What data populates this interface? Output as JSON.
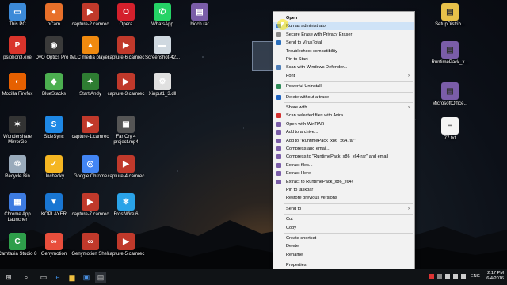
{
  "desktop_icons": [
    {
      "label": "This PC",
      "glyph": "▭",
      "color": "#3c8ad8"
    },
    {
      "label": "oCam",
      "glyph": "●",
      "color": "#e8702a"
    },
    {
      "label": "capture-2.camrec",
      "glyph": "▶",
      "color": "#c0392b"
    },
    {
      "label": "Opera",
      "glyph": "O",
      "color": "#d4202c"
    },
    {
      "label": "WhatsApp",
      "glyph": "✆",
      "color": "#25d366"
    },
    {
      "label": "bioch.rar",
      "glyph": "▤",
      "color": "#7a5da8"
    },
    {
      "label": "psiphon3.exe",
      "glyph": "P",
      "color": "#d9342b"
    },
    {
      "label": "DvO Optics Pro 8",
      "glyph": "◉",
      "color": "#3a3a3a"
    },
    {
      "label": "VLC media player",
      "glyph": "▲",
      "color": "#f08a0f"
    },
    {
      "label": "capture-6.camrec",
      "glyph": "▶",
      "color": "#c0392b"
    },
    {
      "label": "Screenshot-42...",
      "glyph": "▬",
      "color": "#cfd8e0"
    },
    {
      "label": "Mozilla Firefox",
      "glyph": "◐",
      "color": "#e66000"
    },
    {
      "label": "BlueStacks",
      "glyph": "◆",
      "color": "#4caf50"
    },
    {
      "label": "Start Andy",
      "glyph": "✦",
      "color": "#2e7d32"
    },
    {
      "label": "capture-3.camrec",
      "glyph": "▶",
      "color": "#c0392b"
    },
    {
      "label": "Xinput1_3.dll",
      "glyph": "⚙",
      "color": "#e0e0e0"
    },
    {
      "label": "Wondershare MirrorGo",
      "glyph": "✶",
      "color": "#333"
    },
    {
      "label": "SideSync",
      "glyph": "S",
      "color": "#1e88e5"
    },
    {
      "label": "capture-1.camrec",
      "glyph": "▶",
      "color": "#c0392b"
    },
    {
      "label": "Far Cry 4 project.mp4",
      "glyph": "▣",
      "color": "#555"
    },
    {
      "label": "Recycle Bin",
      "glyph": "♲",
      "color": "#9ab"
    },
    {
      "label": "Unchecky",
      "glyph": "✓",
      "color": "#f5b622"
    },
    {
      "label": "Google Chrome",
      "glyph": "◎",
      "color": "#4285f4"
    },
    {
      "label": "capture-4.camrec",
      "glyph": "▶",
      "color": "#c0392b"
    },
    {
      "label": "Chrome App Launcher",
      "glyph": "▦",
      "color": "#3d7be0"
    },
    {
      "label": "KOPLAYER",
      "glyph": "▼",
      "color": "#1976d2"
    },
    {
      "label": "capture-7.camrec",
      "glyph": "▶",
      "color": "#c0392b"
    },
    {
      "label": "FrostWire 6",
      "glyph": "❄",
      "color": "#2aa3e8"
    },
    {
      "label": "Camtasia Studio 8",
      "glyph": "C",
      "color": "#2e9e4a"
    },
    {
      "label": "Genymotion",
      "glyph": "∞",
      "color": "#e84e3c"
    },
    {
      "label": "Genymotion Shell",
      "glyph": "∞",
      "color": "#c0392b"
    },
    {
      "label": "capture-5.camrec",
      "glyph": "▶",
      "color": "#c0392b"
    }
  ],
  "right_icons": [
    {
      "label": "SetupDistrib...",
      "glyph": "▤",
      "color": "#e8c14a"
    },
    {
      "label": "RuntimePack_x...",
      "glyph": "▤",
      "color": "#7a5da8"
    },
    {
      "label": "MicrosoftOffice...",
      "glyph": "▤",
      "color": "#7a5da8"
    },
    {
      "label": "77.txt",
      "glyph": "≡",
      "color": "#f4f4f4"
    }
  ],
  "context_menu": {
    "items": [
      {
        "label": "Open",
        "bold": true,
        "icon": ""
      },
      {
        "label": "Run as administrator",
        "highlight": true,
        "icon": "#3a7bd5"
      },
      {
        "label": "Secure Erase with Privacy Eraser",
        "icon": "#888"
      },
      {
        "label": "Send to VirusTotal",
        "icon": "#2a6ebb"
      },
      {
        "label": "Troubleshoot compatibility",
        "icon": ""
      },
      {
        "label": "Pin to Start",
        "icon": ""
      },
      {
        "label": "Scan with Windows Defender...",
        "icon": "#4f7fb8"
      },
      {
        "label": "Font",
        "icon": "",
        "submenu": true
      },
      {
        "sep": true
      },
      {
        "label": "Powerful Uninstall",
        "icon": "#2e8b57"
      },
      {
        "sep": true
      },
      {
        "label": "Delete without a trace",
        "icon": "#1e63c0"
      },
      {
        "sep": true
      },
      {
        "label": "Share with",
        "icon": "",
        "submenu": true
      },
      {
        "label": "Scan selected files with Avira",
        "icon": "#d32f2f"
      },
      {
        "label": "Open with WinRAR",
        "icon": "#7a5da8"
      },
      {
        "label": "Add to archive...",
        "icon": "#7a5da8"
      },
      {
        "label": "Add to \"RuntimePack_x86_x64.rar\"",
        "icon": "#7a5da8"
      },
      {
        "label": "Compress and email...",
        "icon": "#7a5da8"
      },
      {
        "label": "Compress to \"RuntimePack_x86_x64.rar\" and email",
        "icon": "#7a5da8"
      },
      {
        "label": "Extract files...",
        "icon": "#7a5da8"
      },
      {
        "label": "Extract Here",
        "icon": "#7a5da8"
      },
      {
        "label": "Extract to RuntimePack_x86_x64\\",
        "icon": "#7a5da8"
      },
      {
        "label": "Pin to taskbar",
        "icon": ""
      },
      {
        "label": "Restore previous versions",
        "icon": ""
      },
      {
        "sep": true
      },
      {
        "label": "Send to",
        "icon": "",
        "submenu": true
      },
      {
        "sep": true
      },
      {
        "label": "Cut",
        "icon": ""
      },
      {
        "label": "Copy",
        "icon": ""
      },
      {
        "sep": true
      },
      {
        "label": "Create shortcut",
        "icon": ""
      },
      {
        "label": "Delete",
        "icon": ""
      },
      {
        "label": "Rename",
        "icon": ""
      },
      {
        "sep": true
      },
      {
        "label": "Properties",
        "icon": ""
      }
    ]
  },
  "taskbar": {
    "clock_time": "2:17 PM",
    "clock_date": "6/4/2016",
    "language": "ENG"
  }
}
